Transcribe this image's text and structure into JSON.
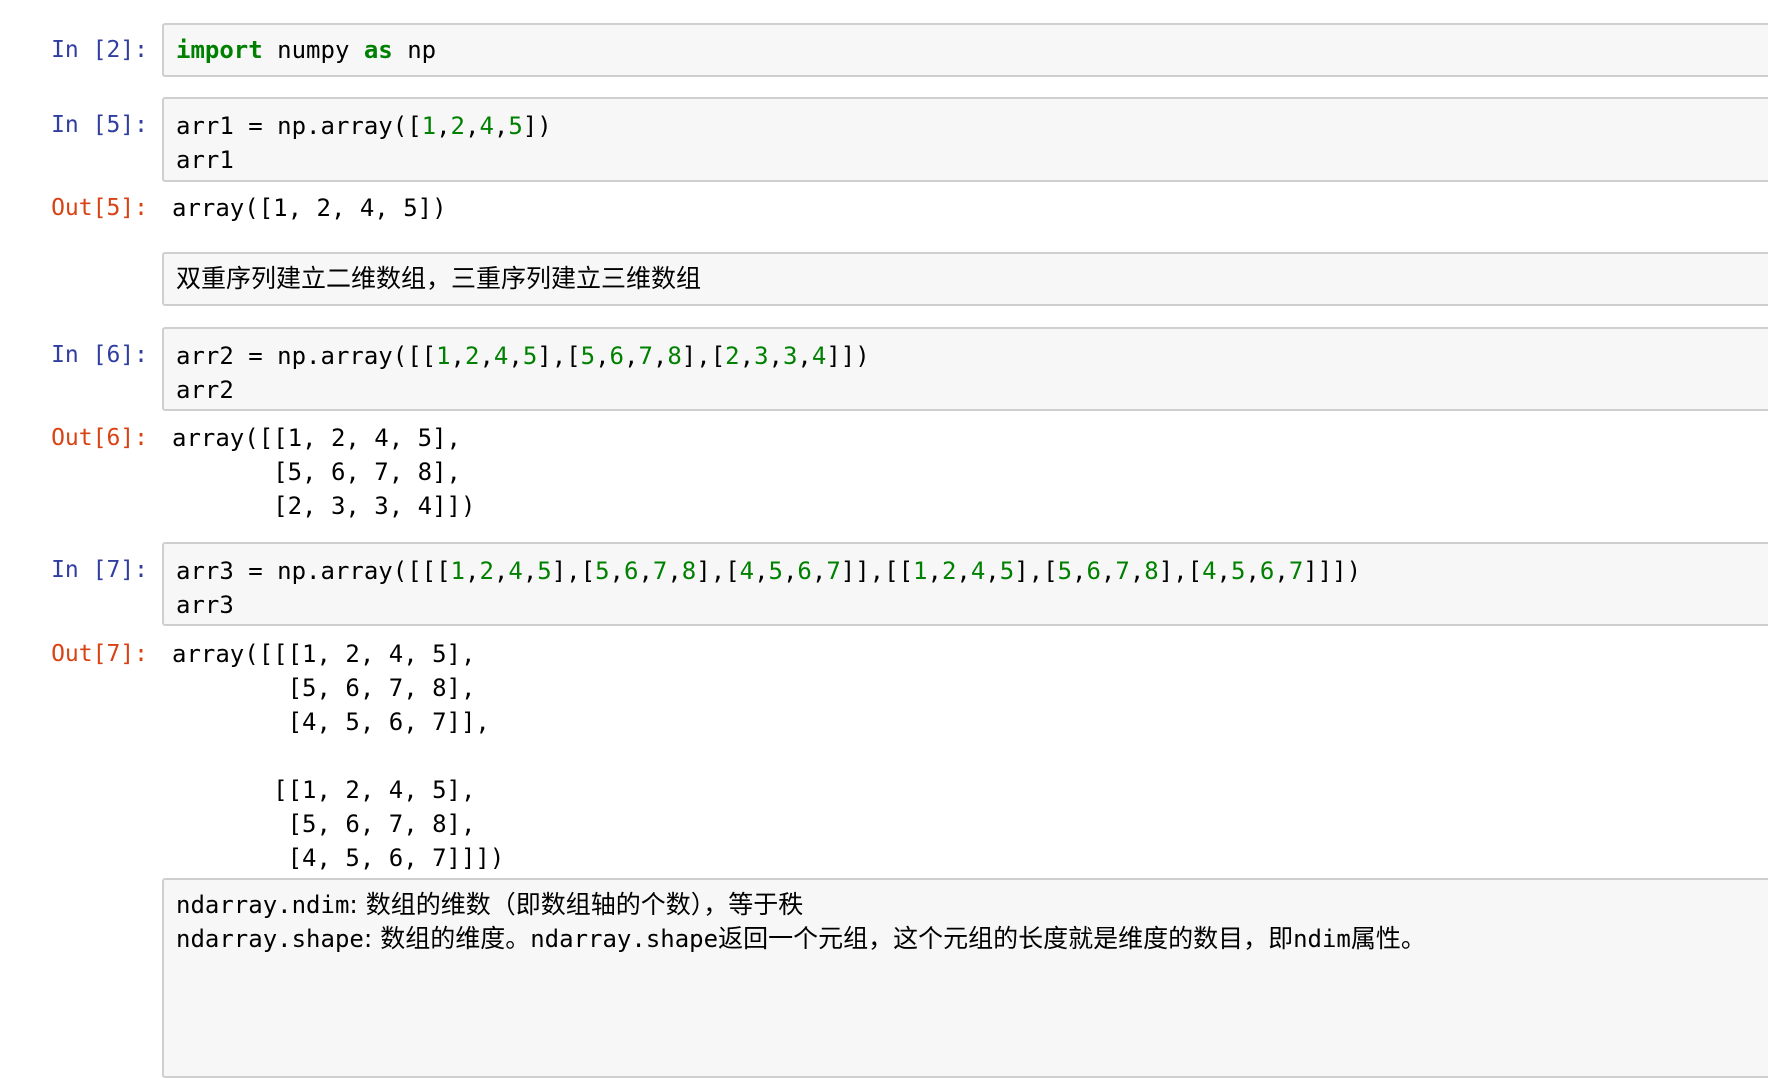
{
  "cells": {
    "c1": {
      "prompt": "In [2]:",
      "kw1": "import",
      "t1": " numpy ",
      "kw2": "as",
      "t2": " np"
    },
    "c2": {
      "prompt": "In [5]:",
      "line1_pre": "arr1 = np.array([",
      "nums": [
        "1",
        "2",
        "4",
        "5"
      ],
      "line1_post": "])",
      "line2": "arr1",
      "out_prompt": "Out[5]:",
      "out": "array([1, 2, 4, 5])"
    },
    "md1": {
      "text": "双重序列建立二维数组，三重序列建立三维数组"
    },
    "c3": {
      "prompt": "In [6]:",
      "line1_pre": "arr2 = np.array([[",
      "nums": [
        "1",
        "2",
        "4",
        "5",
        "5",
        "6",
        "7",
        "8",
        "2",
        "3",
        "3",
        "4"
      ],
      "line1_post": "]])",
      "line2": "arr2",
      "out_prompt": "Out[6]:",
      "out": "array([[1, 2, 4, 5],\n       [5, 6, 7, 8],\n       [2, 3, 3, 4]])"
    },
    "c4": {
      "prompt": "In [7]:",
      "line1_pre": "arr3 = np.array([[[",
      "nums": [
        "1",
        "2",
        "4",
        "5",
        "5",
        "6",
        "7",
        "8",
        "4",
        "5",
        "6",
        "7",
        "1",
        "2",
        "4",
        "5",
        "5",
        "6",
        "7",
        "8",
        "4",
        "5",
        "6",
        "7"
      ],
      "line1_post": "]]])",
      "line2": "arr3",
      "out_prompt": "Out[7]:",
      "out": "array([[[1, 2, 4, 5],\n        [5, 6, 7, 8],\n        [4, 5, 6, 7]],\n\n       [[1, 2, 4, 5],\n        [5, 6, 7, 8],\n        [4, 5, 6, 7]]])"
    },
    "md2": {
      "l1_code": "ndarray.ndim",
      "l1_text": ": 数组的维数（即数组轴的个数），等于秩",
      "l2_code1": "ndarray.shape",
      "l2_text1": ": 数组的维度。",
      "l2_code2": "ndarray.shape",
      "l2_text2": "返回一个元组，这个元组的长度就是维度的数目，即",
      "l2_code3": "ndim",
      "l2_text3": "属性。"
    }
  }
}
